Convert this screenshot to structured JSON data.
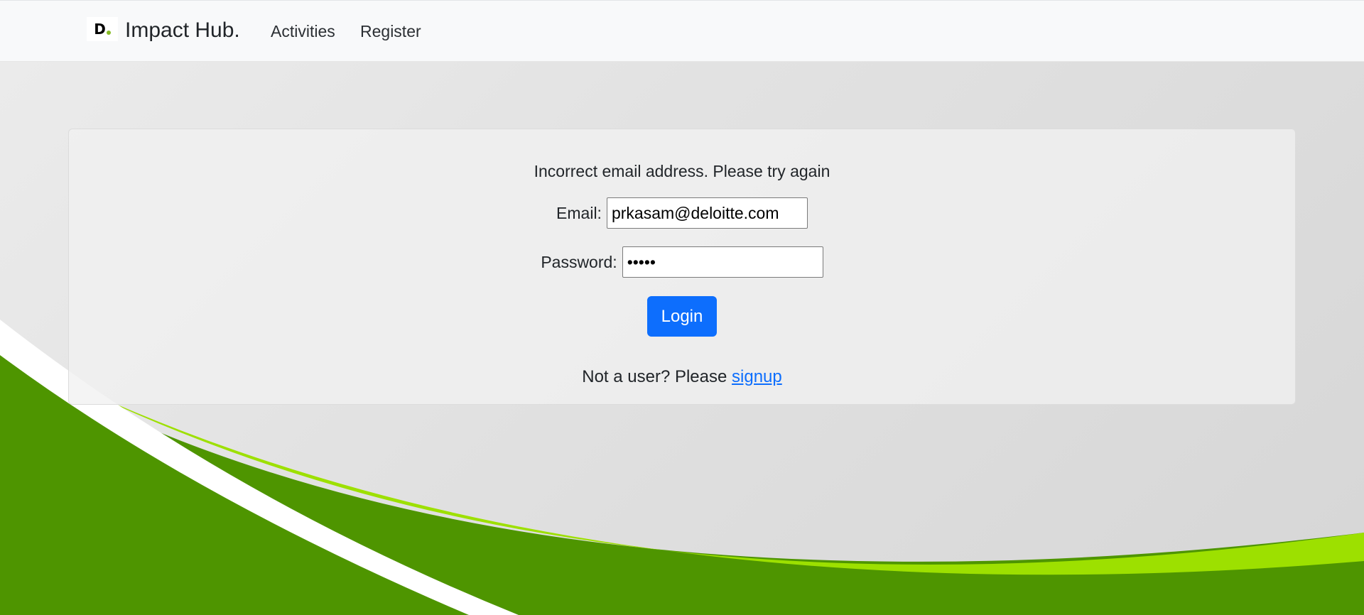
{
  "navbar": {
    "brand_name": "Impact Hub.",
    "logo_letter": "D",
    "links": [
      {
        "label": "Activities"
      },
      {
        "label": "Register"
      }
    ]
  },
  "login_form": {
    "error_message": "Incorrect email address. Please try again",
    "email_label": "Email:",
    "email_value": "prkasam@deloitte.com",
    "password_label": "Password:",
    "password_value": "•••••",
    "login_button_label": "Login",
    "signup_prompt": "Not a user? Please",
    "signup_link_label": "signup"
  },
  "colors": {
    "primary_button": "#0d6efd",
    "brand_green": "#86bc25",
    "wave_dark_green": "#4e9500",
    "wave_light_green": "#9de000",
    "navbar_bg": "#f8f9fa"
  },
  "icons": {
    "logo": "deloitte-d-logo"
  }
}
